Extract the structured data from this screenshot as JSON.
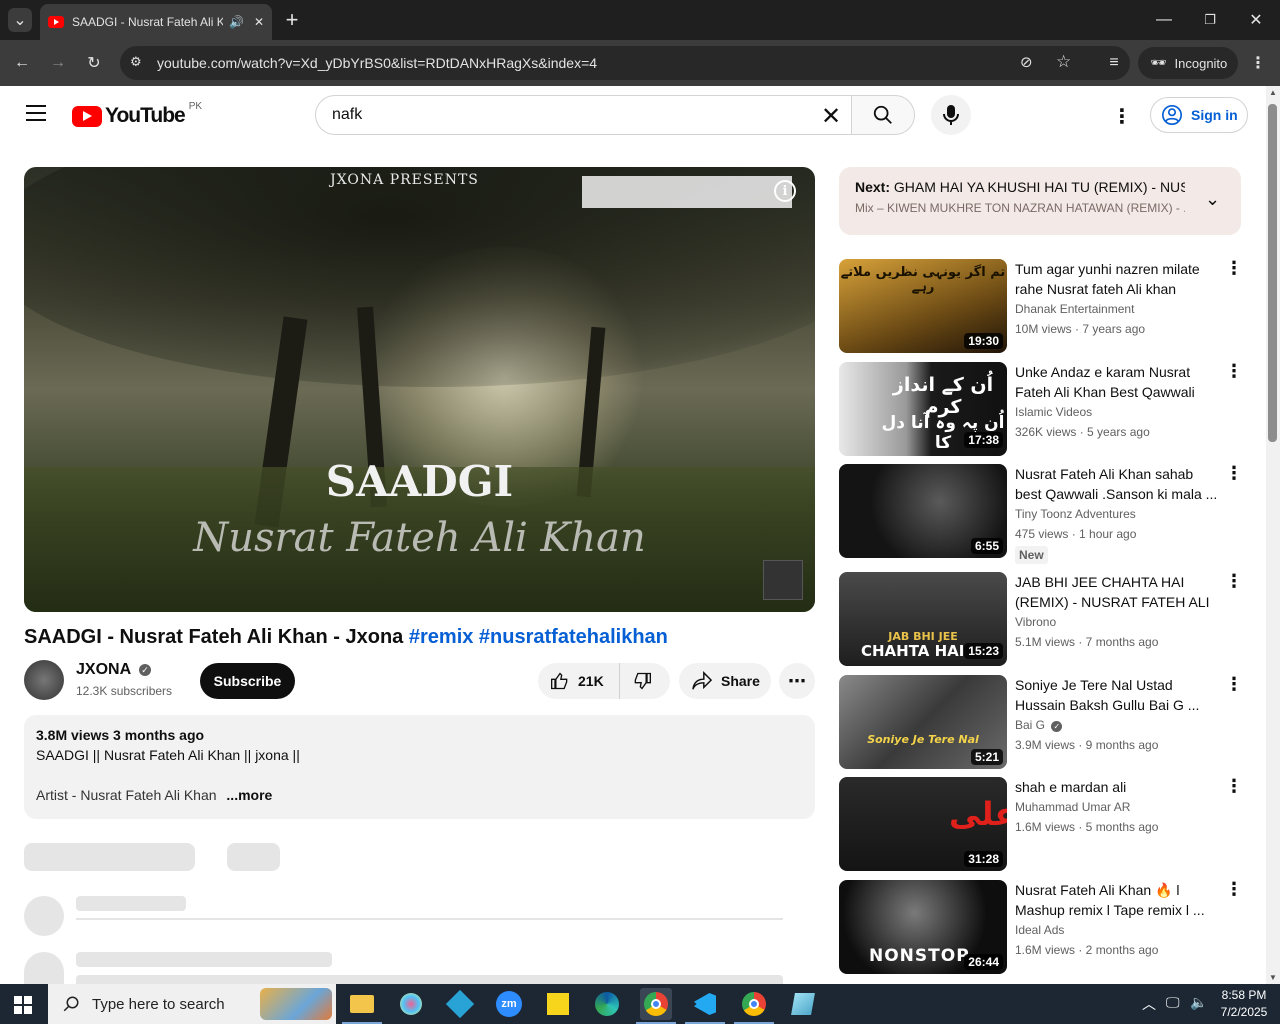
{
  "browser": {
    "tab_title": "SAADGI - Nusrat Fateh Ali Kl",
    "url": "youtube.com/watch?v=Xd_yDbYrBS0&list=RDtDANxHRagXs&index=4",
    "incognito_label": "Incognito"
  },
  "header": {
    "logo_text": "YouTube",
    "country": "PK",
    "search_value": "nafk",
    "sign_in": "Sign in"
  },
  "player": {
    "presents": "JXONA PRESENTS",
    "title_art": "SAADGI",
    "artist_art": "Nusrat Fateh Ali Khan",
    "info": "i"
  },
  "video": {
    "title_main": "SAADGI - Nusrat Fateh Ali Khan - Jxona",
    "hashtags": "#remix #nusratfatehalikhan",
    "channel": "JXONA",
    "subscribers": "12.3K subscribers",
    "subscribe": "Subscribe",
    "likes": "21K",
    "share": "Share"
  },
  "description": {
    "stats": "3.8M views  3 months ago",
    "line1": "SAADGI  || Nusrat Fateh Ali Khan || jxona ||",
    "line2": "Artist - Nusrat Fateh Ali Khan",
    "more": "...more"
  },
  "next": {
    "label": "Next:",
    "title": "GHAM HAI YA KHUSHI HAI TU (REMIX) - NUS...",
    "mix": "Mix – KIWEN MUKHRE TON NAZRAN HATAWAN (REMIX) - ..."
  },
  "recommendations": [
    {
      "title": "Tum agar yunhi nazren milate rahe  Nusrat fateh Ali khan",
      "channel": "Dhanak Entertainment",
      "meta": "10M views · 7 years ago",
      "duration": "19:30",
      "color": "#6b4a14"
    },
    {
      "title": "Unke Andaz e karam Nusrat Fateh Ali Khan Best Qawwali",
      "channel": "Islamic Videos",
      "meta": "326K views · 5 years ago",
      "duration": "17:38",
      "color": "#222222"
    },
    {
      "title": "Nusrat Fateh Ali Khan sahab best Qawwali .Sanson ki mala ...",
      "channel": "Tiny Toonz Adventures",
      "meta": "475 views · 1 hour ago",
      "duration": "6:55",
      "badge": "New",
      "color": "#1a1a1a"
    },
    {
      "title": "JAB BHI JEE CHAHTA HAI (REMIX) - NUSRAT FATEH ALI ...",
      "channel": "Vibrono",
      "meta": "5.1M views · 7 months ago",
      "duration": "15:23",
      "color": "#2a2a2a"
    },
    {
      "title": "Soniye Je Tere Nal Ustad Hussain Baksh Gullu Bai G ...",
      "channel": "Bai G",
      "meta": "3.9M views · 9 months ago",
      "duration": "5:21",
      "color": "#555555"
    },
    {
      "title": "shah e mardan ali",
      "channel": "Muhammad Umar AR",
      "meta": "1.6M views · 5 months ago",
      "duration": "31:28",
      "color": "#1b1b1b"
    },
    {
      "title": "Nusrat Fateh Ali Khan 🔥 l Mashup remix l Tape remix l ...",
      "channel": "Ideal Ads",
      "meta": "1.6M views · 2 months ago",
      "duration": "26:44",
      "color": "#111111"
    }
  ],
  "thumb_texts": {
    "r1": "تم اگر یونہی نظریں ملاتے رہے",
    "r2": "اُن کے انداز کرم",
    "r2b": "اُن پہ وہ آنا دل کا",
    "r4": "JAB BHI JEE",
    "r4b": "CHAHTA HAI",
    "r5": "Soniye Je Tere Nal",
    "r6": "علی",
    "r7": "NONSTOP"
  },
  "taskbar": {
    "search_placeholder": "Type here to search",
    "time": "8:58 PM",
    "date": "7/2/2025"
  }
}
